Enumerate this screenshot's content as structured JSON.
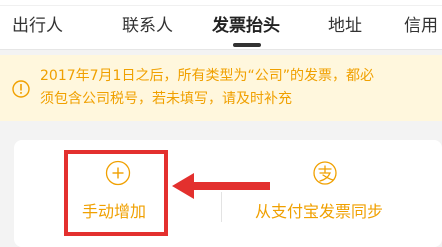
{
  "tabs": [
    {
      "label": "出行人",
      "active": false
    },
    {
      "label": "联系人",
      "active": false
    },
    {
      "label": "发票抬头",
      "active": true
    },
    {
      "label": "地址",
      "active": false
    },
    {
      "label": "信用",
      "active": false
    }
  ],
  "notice": {
    "icon": "info-icon",
    "line1": "2017年7月1日之后，所有类型为“公司”的发票，都必",
    "line2": "须包含公司税号，若未填写，请及时补充"
  },
  "actions": {
    "manual_add": {
      "label": "手动增加",
      "icon": "plus-circle-icon"
    },
    "alipay_sync": {
      "label": "从支付宝发票同步",
      "icon": "alipay-icon"
    }
  },
  "colors": {
    "accent": "#f0a000",
    "notice_bg": "#fff7dd",
    "annotation": "#e3302e"
  }
}
